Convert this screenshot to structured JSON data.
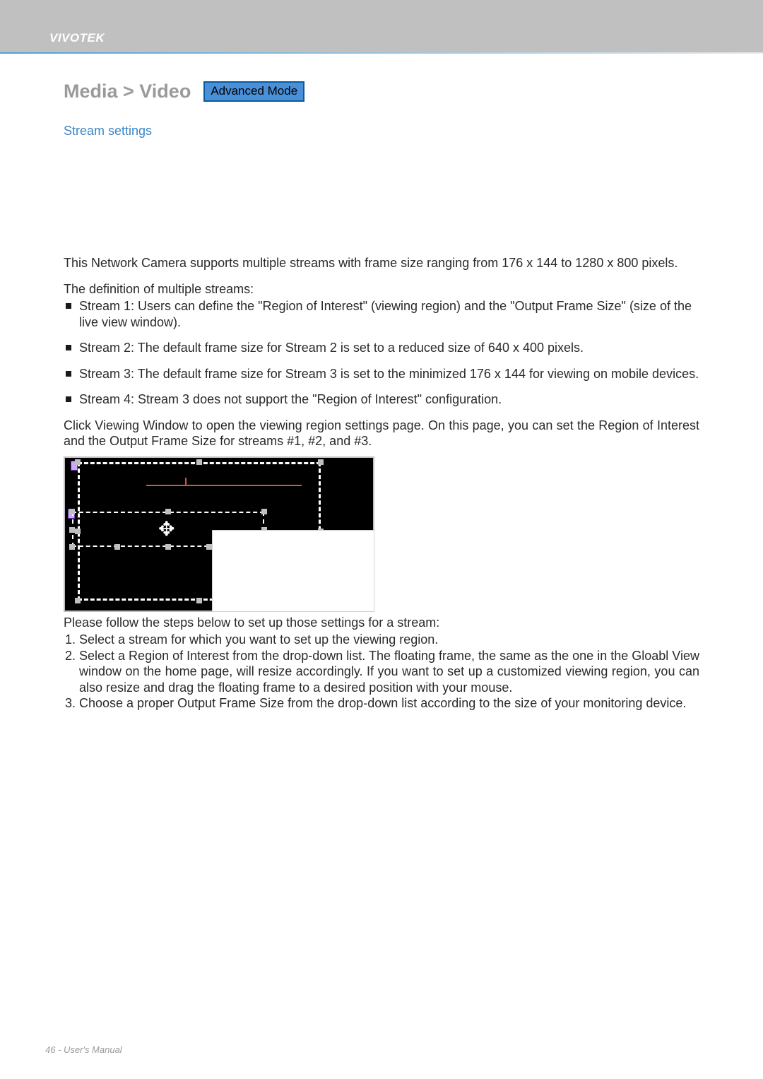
{
  "brand": "VIVOTEK",
  "heading": "Media > Video",
  "badge": "Advanced Mode",
  "subheading": "Stream settings",
  "intro": "This Network Camera supports multiple streams with frame size ranging from 176 x 144 to 1280 x 800 pixels.",
  "defs_title": "The definition of multiple streams:",
  "streams": [
    "Stream 1: Users can define the \"Region of Interest\" (viewing region) and the \"Output Frame Size\" (size of the live view window).",
    "Stream 2: The default frame size for Stream 2 is set to a reduced size of 640 x 400 pixels.",
    "Stream 3: The default frame size for Stream 3 is set to the minimized 176 x 144 for viewing on mobile devices.",
    "Stream 4: Stream 3 does not support the \"Region of Interest\" configuration."
  ],
  "click_para": "Click Viewing Window  to open the viewing region settings page. On this page, you can set the Region of Interest  and the Output Frame Size  for streams #1, #2, and #3.",
  "follow_steps": "Please follow the steps below to set up those settings for a stream:",
  "steps": [
    "Select a stream for which you want to set up the viewing region.",
    "Select a Region of Interest  from the drop-down list. The floating frame, the same as the one in the Gloabl View window on the home page, will resize accordingly. If you want to set up a customized viewing region, you can also resize and drag the floating frame to a desired position with your mouse.",
    "Choose a proper Output Frame Size  from the drop-down list according to the size of your monitoring device."
  ],
  "footer": "46 - User's Manual"
}
